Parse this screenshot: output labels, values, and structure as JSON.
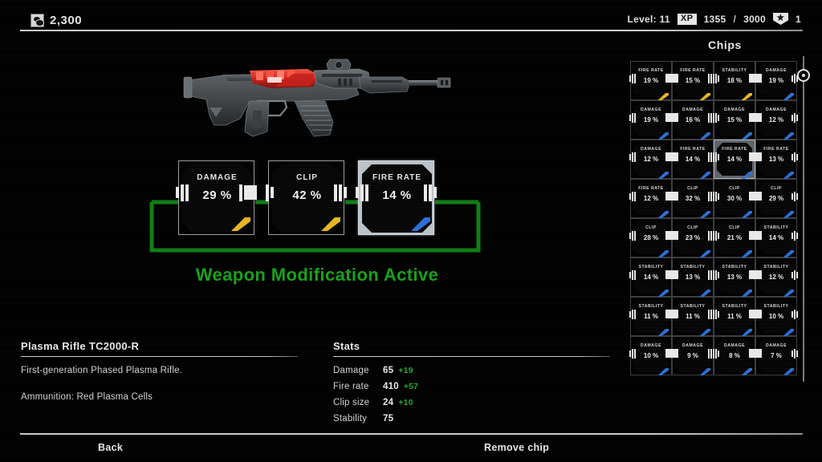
{
  "header": {
    "money_icon": "coin-stack-icon",
    "money": "2,300",
    "level_label": "Level: 11",
    "xp_badge": "XP",
    "xp_current": "1355",
    "xp_separator": "/",
    "xp_max": "3000",
    "star_icon": "star-badge-icon",
    "star_count": "1"
  },
  "weapon": {
    "name": "Plasma Rifle TC2000-R",
    "description": "First-generation Phased Plasma Rifle.",
    "ammunition": "Ammunition: Red Plasma Cells",
    "render_name": "plasma-rifle-render"
  },
  "mod_slots": {
    "status_text": "Weapon Modification Active",
    "status_color": "#17a117",
    "circuit_color": "#0f7d16",
    "slots": [
      {
        "label": "DAMAGE",
        "value": "29 %",
        "stripe_color": "#e5b520",
        "selected": false
      },
      {
        "label": "CLIP",
        "value": "42 %",
        "stripe_color": "#e5b520",
        "selected": false
      },
      {
        "label": "FIRE RATE",
        "value": "14 %",
        "stripe_color": "#2a6fd6",
        "selected": true
      }
    ]
  },
  "stats": {
    "title": "Stats",
    "rows": [
      {
        "name": "Damage",
        "value": "65",
        "bonus": "+19"
      },
      {
        "name": "Fire rate",
        "value": "410",
        "bonus": "+57"
      },
      {
        "name": "Clip size",
        "value": "24",
        "bonus": "+10"
      },
      {
        "name": "Stability",
        "value": "75",
        "bonus": ""
      }
    ],
    "bonus_color": "#1faa2a"
  },
  "chips_panel": {
    "title": "Chips",
    "scrollbar": "chips-scrollbar",
    "chips": [
      {
        "label": "FIRE RATE",
        "value": "19 %",
        "stripe_color": "#e5b520",
        "selected": false
      },
      {
        "label": "FIRE RATE",
        "value": "15 %",
        "stripe_color": "#e5b520",
        "selected": false
      },
      {
        "label": "STABILITY",
        "value": "18 %",
        "stripe_color": "#e5b520",
        "selected": false
      },
      {
        "label": "DAMAGE",
        "value": "19 %",
        "stripe_color": "#2a6fd6",
        "selected": false
      },
      {
        "label": "DAMAGE",
        "value": "19 %",
        "stripe_color": "#2a6fd6",
        "selected": false
      },
      {
        "label": "DAMAGE",
        "value": "16 %",
        "stripe_color": "#2a6fd6",
        "selected": false
      },
      {
        "label": "DAMAGE",
        "value": "15 %",
        "stripe_color": "#2a6fd6",
        "selected": false
      },
      {
        "label": "DAMAGE",
        "value": "12 %",
        "stripe_color": "#2a6fd6",
        "selected": false
      },
      {
        "label": "DAMAGE",
        "value": "12 %",
        "stripe_color": "#2a6fd6",
        "selected": false
      },
      {
        "label": "FIRE RATE",
        "value": "14 %",
        "stripe_color": "#2a6fd6",
        "selected": false
      },
      {
        "label": "FIRE RATE",
        "value": "14 %",
        "stripe_color": "#2a6fd6",
        "selected": true
      },
      {
        "label": "FIRE RATE",
        "value": "13 %",
        "stripe_color": "#2a6fd6",
        "selected": false
      },
      {
        "label": "FIRE RATE",
        "value": "12 %",
        "stripe_color": "#2a6fd6",
        "selected": false
      },
      {
        "label": "CLIP",
        "value": "32 %",
        "stripe_color": "#2a6fd6",
        "selected": false
      },
      {
        "label": "CLIP",
        "value": "30 %",
        "stripe_color": "#2a6fd6",
        "selected": false
      },
      {
        "label": "CLIP",
        "value": "29 %",
        "stripe_color": "#2a6fd6",
        "selected": false
      },
      {
        "label": "CLIP",
        "value": "28 %",
        "stripe_color": "#2a6fd6",
        "selected": false
      },
      {
        "label": "CLIP",
        "value": "23 %",
        "stripe_color": "#2a6fd6",
        "selected": false
      },
      {
        "label": "CLIP",
        "value": "21 %",
        "stripe_color": "#2a6fd6",
        "selected": false
      },
      {
        "label": "STABILITY",
        "value": "14 %",
        "stripe_color": "#2a6fd6",
        "selected": false
      },
      {
        "label": "STABILITY",
        "value": "14 %",
        "stripe_color": "#2a6fd6",
        "selected": false
      },
      {
        "label": "STABILITY",
        "value": "13 %",
        "stripe_color": "#2a6fd6",
        "selected": false
      },
      {
        "label": "STABILITY",
        "value": "13 %",
        "stripe_color": "#2a6fd6",
        "selected": false
      },
      {
        "label": "STABILITY",
        "value": "12 %",
        "stripe_color": "#2a6fd6",
        "selected": false
      },
      {
        "label": "STABILITY",
        "value": "11 %",
        "stripe_color": "#2a6fd6",
        "selected": false
      },
      {
        "label": "STABILITY",
        "value": "11 %",
        "stripe_color": "#2a6fd6",
        "selected": false
      },
      {
        "label": "STABILITY",
        "value": "11 %",
        "stripe_color": "#2a6fd6",
        "selected": false
      },
      {
        "label": "STABILITY",
        "value": "10 %",
        "stripe_color": "#2a6fd6",
        "selected": false
      },
      {
        "label": "DAMAGE",
        "value": "10 %",
        "stripe_color": "#2a6fd6",
        "selected": false
      },
      {
        "label": "DAMAGE",
        "value": "9 %",
        "stripe_color": "#2a6fd6",
        "selected": false
      },
      {
        "label": "DAMAGE",
        "value": "8 %",
        "stripe_color": "#2a6fd6",
        "selected": false
      },
      {
        "label": "DAMAGE",
        "value": "7 %",
        "stripe_color": "#2a6fd6",
        "selected": false
      }
    ]
  },
  "footer": {
    "back_label": "Back",
    "remove_label": "Remove chip"
  }
}
